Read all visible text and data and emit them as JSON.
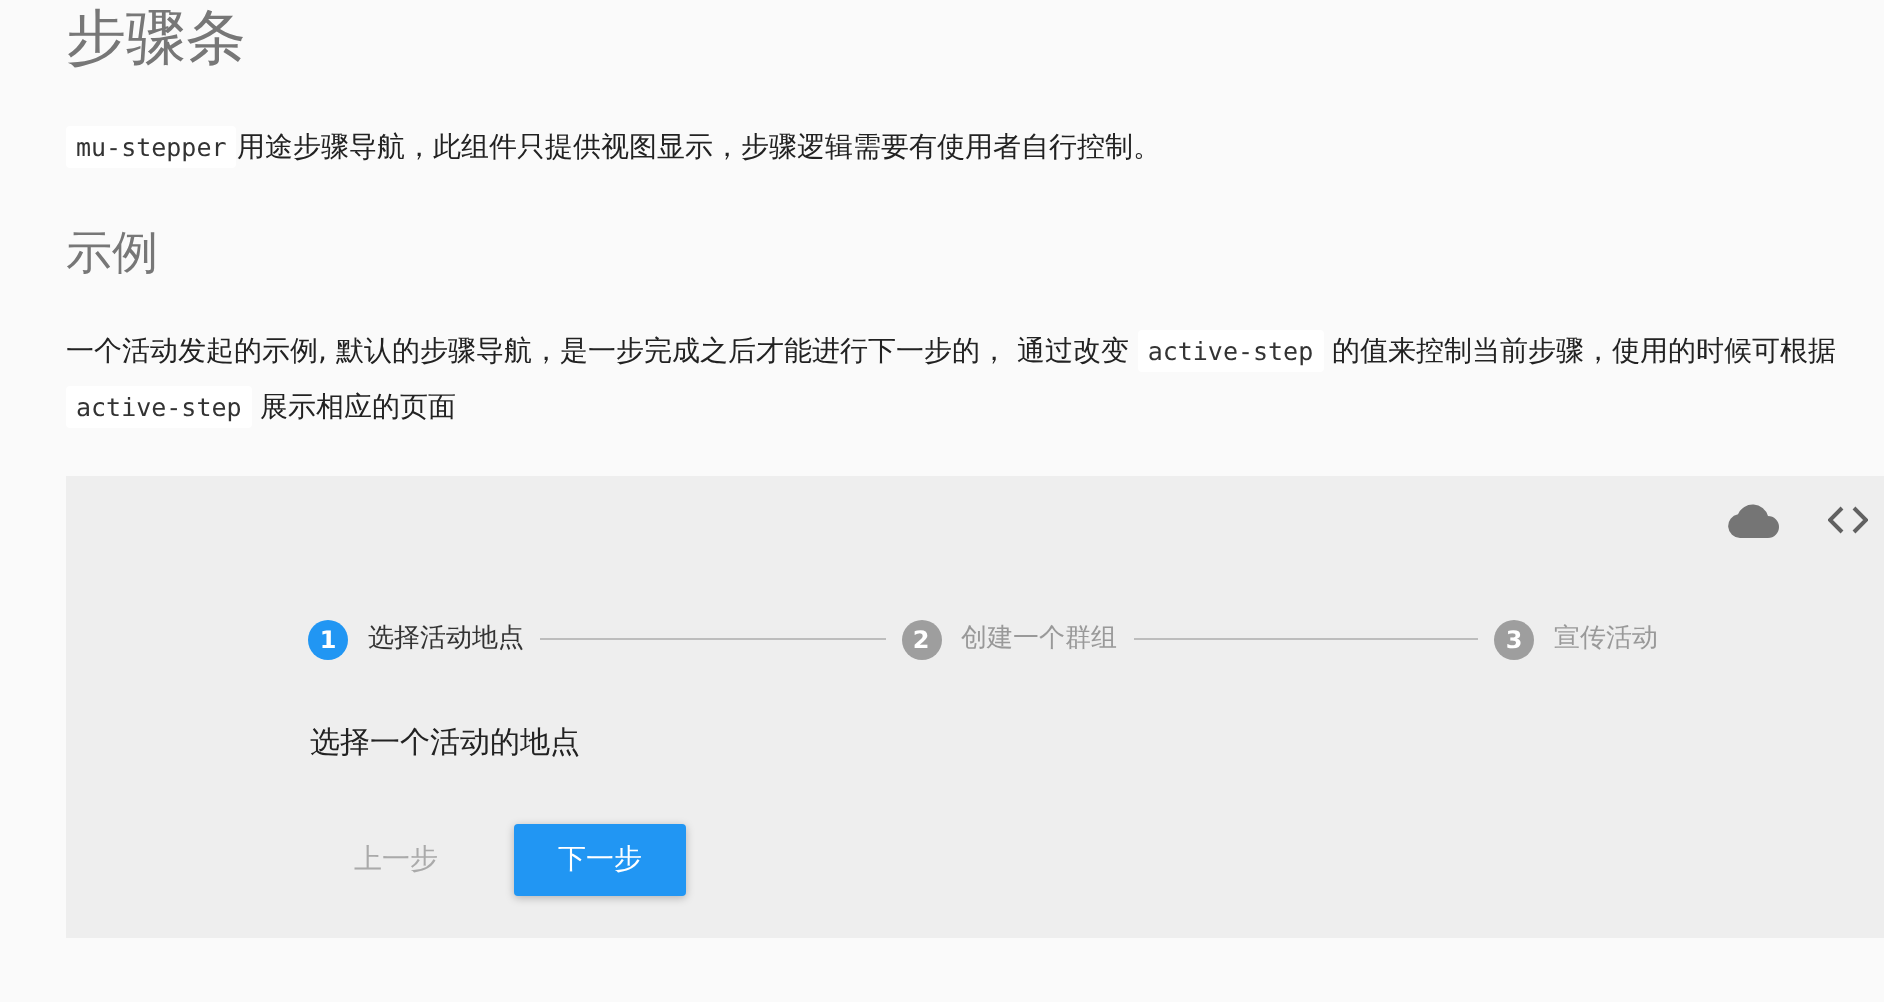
{
  "title": "步骤条",
  "intro": [
    {
      "kind": "code",
      "text": "mu-stepper"
    },
    {
      "kind": "text",
      "text": "用途步骤导航，此组件只提供视图显示，步骤逻辑需要有使用者自行控制。"
    }
  ],
  "section_title": "示例",
  "description": [
    {
      "kind": "text",
      "text": "一个活动发起的示例, 默认的步骤导航，是一步完成之后才能进行下一步的， 通过改变 "
    },
    {
      "kind": "code",
      "text": "active-step"
    },
    {
      "kind": "text",
      "text": " 的值来控制当前步骤，使用的时候可根据 "
    },
    {
      "kind": "code",
      "text": "active-step"
    },
    {
      "kind": "text",
      "text": " 展示相应的页面"
    }
  ],
  "demo": {
    "steps": [
      {
        "number": "1",
        "label": "选择活动地点",
        "selected": true
      },
      {
        "number": "2",
        "label": "创建一个群组",
        "selected": false
      },
      {
        "number": "3",
        "label": "宣传活动",
        "selected": false
      }
    ],
    "content": "选择一个活动的地点",
    "buttons": [
      {
        "label": "上一步",
        "kind": "flat",
        "disabled": true
      },
      {
        "label": "下一步",
        "kind": "raised",
        "disabled": false
      }
    ]
  }
}
